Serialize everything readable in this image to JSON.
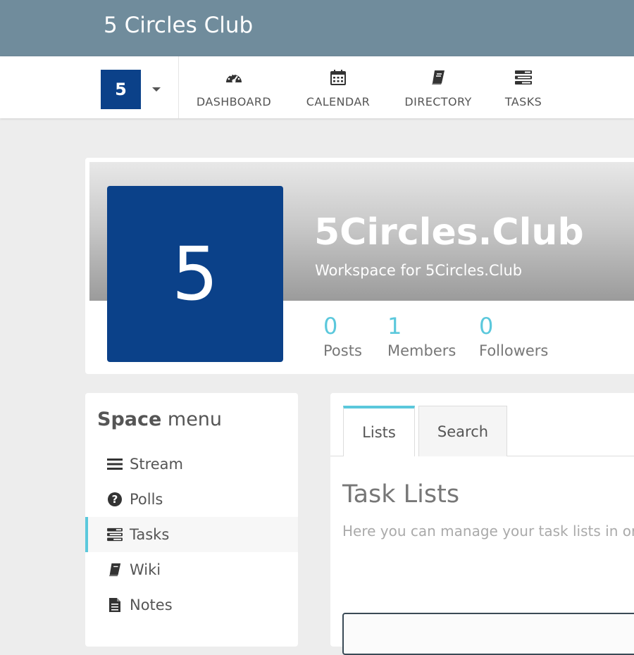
{
  "app": {
    "title": "5 Circles Club"
  },
  "space_chooser": {
    "initial": "5"
  },
  "nav": [
    {
      "label": "DASHBOARD",
      "icon": "dashboard-icon"
    },
    {
      "label": "CALENDAR",
      "icon": "calendar-icon"
    },
    {
      "label": "DIRECTORY",
      "icon": "book-icon"
    },
    {
      "label": "TASKS",
      "icon": "tasks-icon"
    }
  ],
  "profile": {
    "avatar_initial": "5",
    "name": "5Circles.Club",
    "description": "Workspace for 5Circles.Club",
    "stats": [
      {
        "value": "0",
        "label": "Posts"
      },
      {
        "value": "1",
        "label": "Members"
      },
      {
        "value": "0",
        "label": "Followers"
      }
    ]
  },
  "space_menu": {
    "title_bold": "Space",
    "title_rest": " menu",
    "items": [
      {
        "label": "Stream",
        "icon": "bars-icon"
      },
      {
        "label": "Polls",
        "icon": "question-circle-icon"
      },
      {
        "label": "Tasks",
        "icon": "tasks-icon",
        "active": true
      },
      {
        "label": "Wiki",
        "icon": "book-icon"
      },
      {
        "label": "Notes",
        "icon": "file-text-icon"
      }
    ]
  },
  "tasks_panel": {
    "tabs": [
      {
        "label": "Lists",
        "active": true
      },
      {
        "label": "Search",
        "active": false
      }
    ],
    "title": "Task Lists",
    "description": "Here you can manage your task lists in or"
  },
  "colors": {
    "topbar": "#708c9c",
    "brand_blue": "#0b4189",
    "accent": "#5bc8dc",
    "background": "#ededed"
  }
}
